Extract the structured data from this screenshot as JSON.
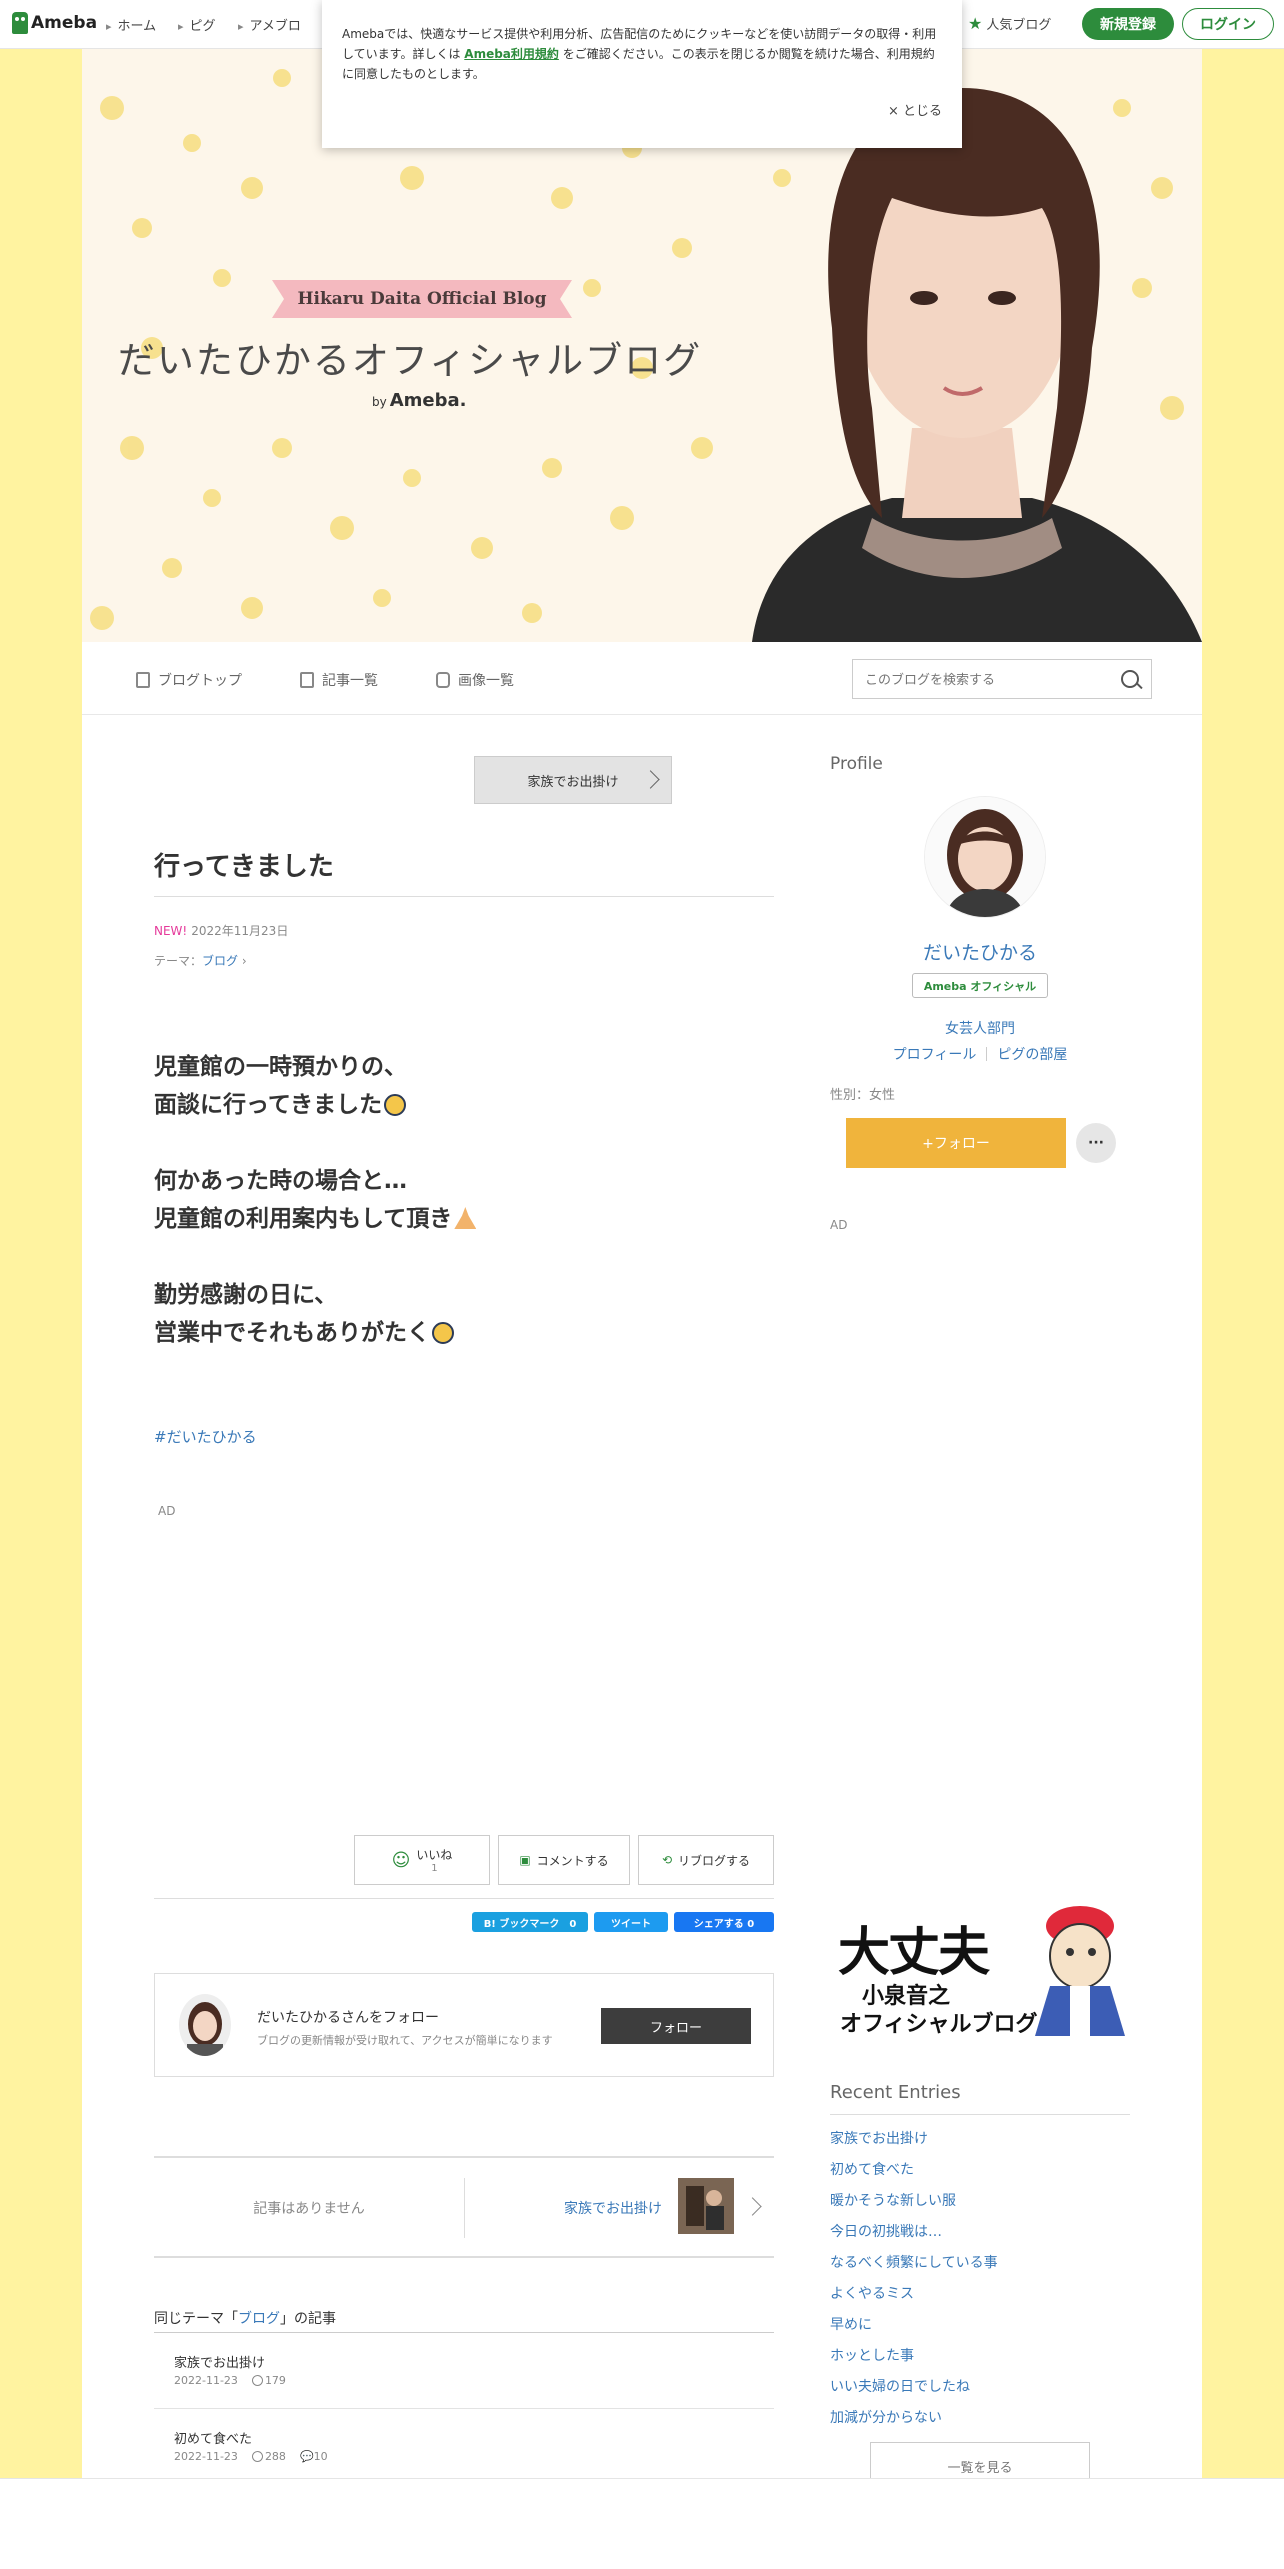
{
  "global_header": {
    "logo": "Ameba",
    "nav": [
      "ホーム",
      "ピグ",
      "アメブロ"
    ],
    "popular": "人気ブログ",
    "register": "新規登録",
    "login": "ログイン"
  },
  "cookie": {
    "text_before": "Amebaでは、快適なサービス提供や利用分析、広告配信のためにクッキーなどを使い訪問データの取得・利用しています。詳しくは",
    "link": "Ameba利用規約",
    "text_after": "をご確認ください。この表示を閉じるか閲覧を続けた場合、利用規約に同意したものとします。",
    "close": "× とじる"
  },
  "hero": {
    "ribbon": "Hikaru Daita Official Blog",
    "title": "だいたひかるオフィシャルブログ",
    "by": "by",
    "ameba": "Ameba."
  },
  "blognav": {
    "items": [
      "ブログトップ",
      "記事一覧",
      "画像一覧"
    ],
    "search_placeholder": "このブログを検索する"
  },
  "article": {
    "next_top": "家族でお出掛け",
    "title": "行ってきました",
    "new_label": "NEW!",
    "date": "2022年11月23日",
    "theme_label": "テーマ：",
    "theme": "ブログ",
    "paragraphs": [
      [
        "児童館の一時預かりの、",
        "面談に行ってきました"
      ],
      [
        "何かあった時の場合と…",
        "児童館の利用案内もして頂き"
      ],
      [
        "勤労感謝の日に、",
        "営業中でそれもありがたく"
      ]
    ],
    "hashtag": "#だいたひかる",
    "ad": "AD"
  },
  "reactions": {
    "like": "いいね",
    "like_count": "1",
    "comment": "コメントする",
    "reblog": "リブログする"
  },
  "share": {
    "hatena": "B! ブックマーク　0",
    "tweet": "ツイート",
    "facebook": "シェアする 0"
  },
  "followbox": {
    "name": "だいたひかるさんをフォロー",
    "desc": "ブログの更新情報が受け取れて、アクセスが簡単になります",
    "button": "フォロー"
  },
  "prevnext": {
    "prev": "記事はありません",
    "next": "家族でお出掛け"
  },
  "same_theme": {
    "prefix": "同じテーマ「",
    "theme": "ブログ",
    "suffix": "」の記事",
    "items": [
      {
        "title": "家族でお出掛け",
        "date": "2022-11-23",
        "likes": "179",
        "comments": ""
      },
      {
        "title": "初めて食べた",
        "date": "2022-11-23",
        "likes": "288",
        "comments": "10"
      }
    ]
  },
  "sidebar": {
    "profile_head": "Profile",
    "name": "だいたひかる",
    "badge": "Ameba オフィシャル",
    "dept": "女芸人部門",
    "links": [
      "プロフィール",
      "ピグの部屋"
    ],
    "gender": "性別：女性",
    "follow": "+フォロー",
    "more": "···",
    "ad": "AD",
    "banner": {
      "big": "大丈夫",
      "sub1": "小泉音之",
      "sub2": "オフィシャルブログ"
    },
    "recent_head": "Recent Entries",
    "recent": [
      "家族でお出掛け",
      "初めて食べた",
      "暖かそうな新しい服",
      "今日の初挑戦は…",
      "なるべく頻繁にしている事",
      "よくやるミス",
      "早めに",
      "ホッとした事",
      "いい夫婦の日でしたね",
      "加減が分からない"
    ],
    "see_all": "一覧を見る"
  },
  "colors": {
    "background": "#fff3a0",
    "ameba_green": "#2d8c3c",
    "link": "#3a79b8",
    "follow": "#f0b43c",
    "new": "#e5399a"
  }
}
